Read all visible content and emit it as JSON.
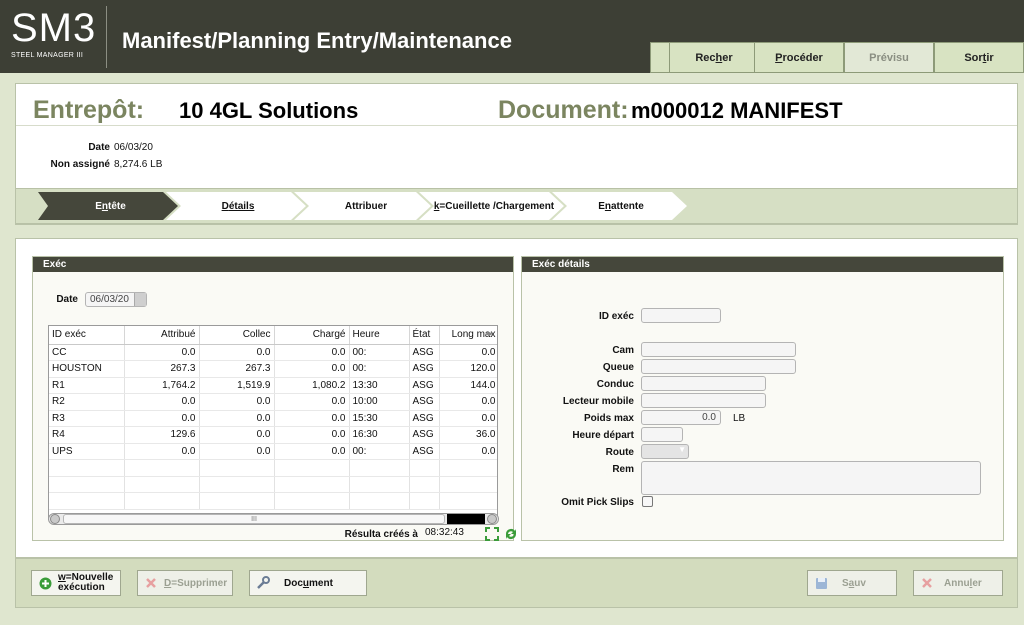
{
  "app": {
    "logo_main": "SM3",
    "logo_sub": "STEEL MANAGER III",
    "title": "Manifest/Planning Entry/Maintenance"
  },
  "topbar": {
    "recher_pre": "Rec",
    "recher_u": "h",
    "recher_post": "er",
    "proceder_u": "P",
    "proceder_post": "rocéder",
    "previsu": "Prévisu",
    "sortir_pre": "Sor",
    "sortir_u": "t",
    "sortir_post": "ir"
  },
  "header": {
    "warehouse_label": "Entrepôt:",
    "warehouse_value": "10 4GL Solutions",
    "document_label": "Document:",
    "document_value": "m000012 MANIFEST",
    "date_label": "Date",
    "date_value": "06/03/20",
    "unassigned_label": "Non assigné",
    "unassigned_value": "8,274.6 LB"
  },
  "process_tabs": {
    "entete_pre": "E",
    "entete_u": "n",
    "entete_post": "tête",
    "details_u": "D",
    "details_post": "étails",
    "attribuer": "Attribuer",
    "cueillette_u": "k",
    "cueillette_post": "=Cueillette /Chargement",
    "attente_pre": "E",
    "attente_u": "n",
    "attente_post": " attente"
  },
  "exec_panel": {
    "title": "Exéc",
    "date_label": "Date",
    "date_value": "06/03/20",
    "columns": [
      "ID exéc",
      "Attribué",
      "Collec",
      "Chargé",
      "Heure",
      "État",
      "Long max"
    ],
    "rows": [
      [
        "CC",
        "0.0",
        "0.0",
        "0.0",
        "00:",
        "ASG",
        "0.0"
      ],
      [
        "HOUSTON",
        "267.3",
        "267.3",
        "0.0",
        "00:",
        "ASG",
        "120.0"
      ],
      [
        "R1",
        "1,764.2",
        "1,519.9",
        "1,080.2",
        "13:30",
        "ASG",
        "144.0"
      ],
      [
        "R2",
        "0.0",
        "0.0",
        "0.0",
        "10:00",
        "ASG",
        "0.0"
      ],
      [
        "R3",
        "0.0",
        "0.0",
        "0.0",
        "15:30",
        "ASG",
        "0.0"
      ],
      [
        "R4",
        "129.6",
        "0.0",
        "0.0",
        "16:30",
        "ASG",
        "36.0"
      ],
      [
        "UPS",
        "0.0",
        "0.0",
        "0.0",
        "00:",
        "ASG",
        "0.0"
      ]
    ],
    "scroll_grip": "III",
    "results_label": "Résulta créés à",
    "results_time": "08:32:43"
  },
  "details_panel": {
    "title": "Exéc détails",
    "id_label": "ID exéc",
    "truck_label": "Cam",
    "trailer_label": "Queue",
    "driver_label": "Conduc",
    "reader_label": "Lecteur mobile",
    "maxweight_label": "Poids max",
    "maxweight_value": "0.0",
    "maxweight_unit": "LB",
    "departure_label": "Heure départ",
    "route_label": "Route",
    "rem_label": "Rem",
    "omit_label": "Omit Pick Slips"
  },
  "footer": {
    "new_u": "w",
    "new_post": "=Nouvelle",
    "new_line2": "exécution",
    "delete_u": "D",
    "delete_post": "=Supprimer",
    "document_pre": "Doc",
    "document_u": "u",
    "document_post": "ment",
    "save_pre": "S",
    "save_u": "a",
    "save_post": "uv",
    "cancel_pre": "Annu",
    "cancel_u": "l",
    "cancel_post": "er"
  },
  "colors": {
    "header_bg": "#3d3f35",
    "accent_olive": "#7b8560",
    "panel_tab_bg": "#d6dfc4"
  }
}
